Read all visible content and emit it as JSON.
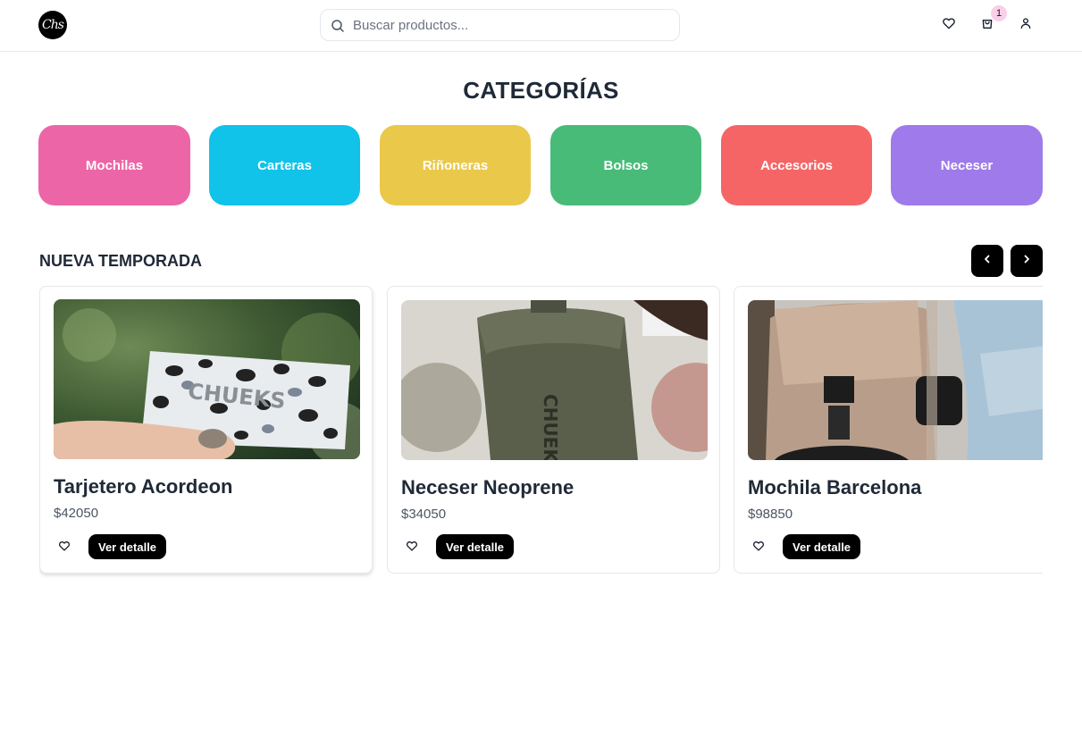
{
  "header": {
    "logo_text": "Chs",
    "search_placeholder": "Buscar productos...",
    "cart_count": "1",
    "icons": [
      "search-icon",
      "heart-icon",
      "cart-icon",
      "user-icon"
    ]
  },
  "categories": {
    "title": "CATEGORÍAS",
    "items": [
      {
        "label": "Mochilas",
        "color": "#ec65a6"
      },
      {
        "label": "Carteras",
        "color": "#11c2e9"
      },
      {
        "label": "Riñoneras",
        "color": "#eac84a"
      },
      {
        "label": "Bolsos",
        "color": "#48bb78"
      },
      {
        "label": "Accesorios",
        "color": "#f56565"
      },
      {
        "label": "Neceser",
        "color": "#9f7aea"
      }
    ]
  },
  "new_season": {
    "title": "NUEVA TEMPORADA",
    "products": [
      {
        "name": "Tarjetero Acordeon",
        "price": "$42050",
        "button": "Ver detalle",
        "image_text": "CHUEKS"
      },
      {
        "name": "Neceser Neoprene",
        "price": "$34050",
        "button": "Ver detalle",
        "image_text": "CHUEKS"
      },
      {
        "name": "Mochila Barcelona",
        "price": "$98850",
        "button": "Ver detalle"
      }
    ]
  }
}
